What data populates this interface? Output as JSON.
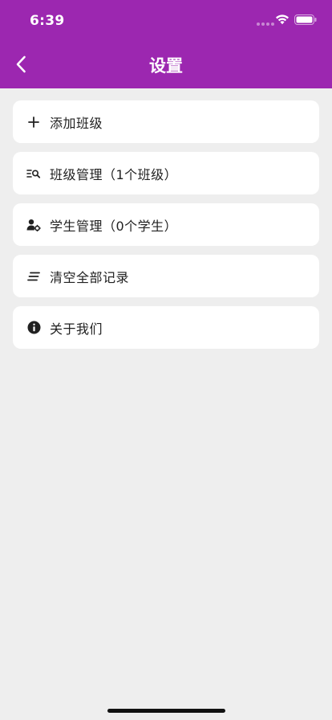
{
  "status": {
    "time": "6:39"
  },
  "header": {
    "title": "设置"
  },
  "menu": [
    {
      "label": "添加班级",
      "icon": "plus-icon"
    },
    {
      "label": "班级管理（1个班级）",
      "icon": "list-search-icon"
    },
    {
      "label": "学生管理（0个学生）",
      "icon": "user-gear-icon"
    },
    {
      "label": "清空全部记录",
      "icon": "clear-lines-icon"
    },
    {
      "label": "关于我们",
      "icon": "info-icon"
    }
  ],
  "colors": {
    "primary": "#9c27b0",
    "background": "#eeeeee",
    "card": "#ffffff"
  }
}
